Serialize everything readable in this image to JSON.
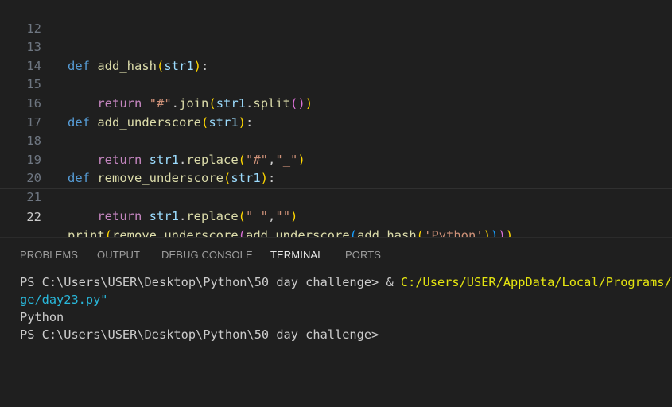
{
  "editor": {
    "line_numbers": [
      "12",
      "13",
      "14",
      "15",
      "16",
      "17",
      "18",
      "19",
      "20",
      "21",
      "22"
    ],
    "current_line": "22",
    "tokens": {
      "def": "def",
      "return": "return",
      "print": "print",
      "add_hash": "add_hash",
      "add_underscore": "add_underscore",
      "remove_underscore": "remove_underscore",
      "str1": "str1",
      "join": "join",
      "split": "split",
      "replace": "replace",
      "hash_str": "\"#\"",
      "underscore_str": "\"_\"",
      "empty_str": "\"\"",
      "python_str": "'Python'"
    }
  },
  "panel": {
    "tabs": [
      {
        "label": "PROBLEMS",
        "active": false
      },
      {
        "label": "OUTPUT",
        "active": false
      },
      {
        "label": "DEBUG CONSOLE",
        "active": false
      },
      {
        "label": "TERMINAL",
        "active": true
      },
      {
        "label": "PORTS",
        "active": false
      }
    ]
  },
  "terminal": {
    "prompt_1": "PS C:\\Users\\USER\\Desktop\\Python\\50 day challenge> ",
    "call_operator": "& ",
    "exe_path": "C:/Users/USER/AppData/Local/Programs/Py",
    "script_path_wrap": "ge/day23.py\"",
    "output": "Python",
    "prompt_2": "PS C:\\Users\\USER\\Desktop\\Python\\50 day challenge>"
  },
  "colors": {
    "background": "#1f1f1f",
    "keyword": "#569cd6",
    "function": "#dcdcaa",
    "variable": "#9cdcfe",
    "string": "#ce9178",
    "bracket_1": "#ffd700",
    "bracket_2": "#da70d6",
    "bracket_3": "#179fff",
    "active_tab_underline": "#0078d4",
    "terminal_yellow": "#e5e510",
    "terminal_cyan": "#29b8db"
  }
}
